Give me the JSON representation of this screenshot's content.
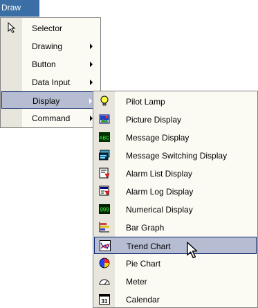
{
  "menubar": {
    "title": "Draw"
  },
  "main_menu": {
    "items": [
      {
        "label": "Selector"
      },
      {
        "label": "Drawing"
      },
      {
        "label": "Button"
      },
      {
        "label": "Data Input"
      },
      {
        "label": "Display"
      },
      {
        "label": "Command"
      }
    ]
  },
  "display_menu": {
    "items": [
      {
        "label": "Pilot Lamp",
        "icon": "lamp-icon"
      },
      {
        "label": "Picture Display",
        "icon": "picture-icon"
      },
      {
        "label": "Message Display",
        "icon": "message-display-icon"
      },
      {
        "label": "Message Switching Display",
        "icon": "message-switching-icon"
      },
      {
        "label": "Alarm List Display",
        "icon": "alarm-list-icon"
      },
      {
        "label": "Alarm Log Display",
        "icon": "alarm-log-icon"
      },
      {
        "label": "Numerical Display",
        "icon": "numerical-display-icon"
      },
      {
        "label": "Bar Graph",
        "icon": "bar-graph-icon"
      },
      {
        "label": "Trend Chart",
        "icon": "trend-chart-icon"
      },
      {
        "label": "Pie Chart",
        "icon": "pie-chart-icon"
      },
      {
        "label": "Meter",
        "icon": "meter-icon"
      },
      {
        "label": "Calendar",
        "icon": "calendar-icon"
      }
    ]
  },
  "icon_text": {
    "message_display": "ABC",
    "numerical_display": "999",
    "calendar": "31"
  },
  "colors": {
    "menubar_bg": "#3a6ea5",
    "menu_bg": "#fbfaf3",
    "gutter_bg": "#e8e6dc",
    "highlight_bg": "#b6bdd2",
    "highlight_border": "#0a246a"
  }
}
